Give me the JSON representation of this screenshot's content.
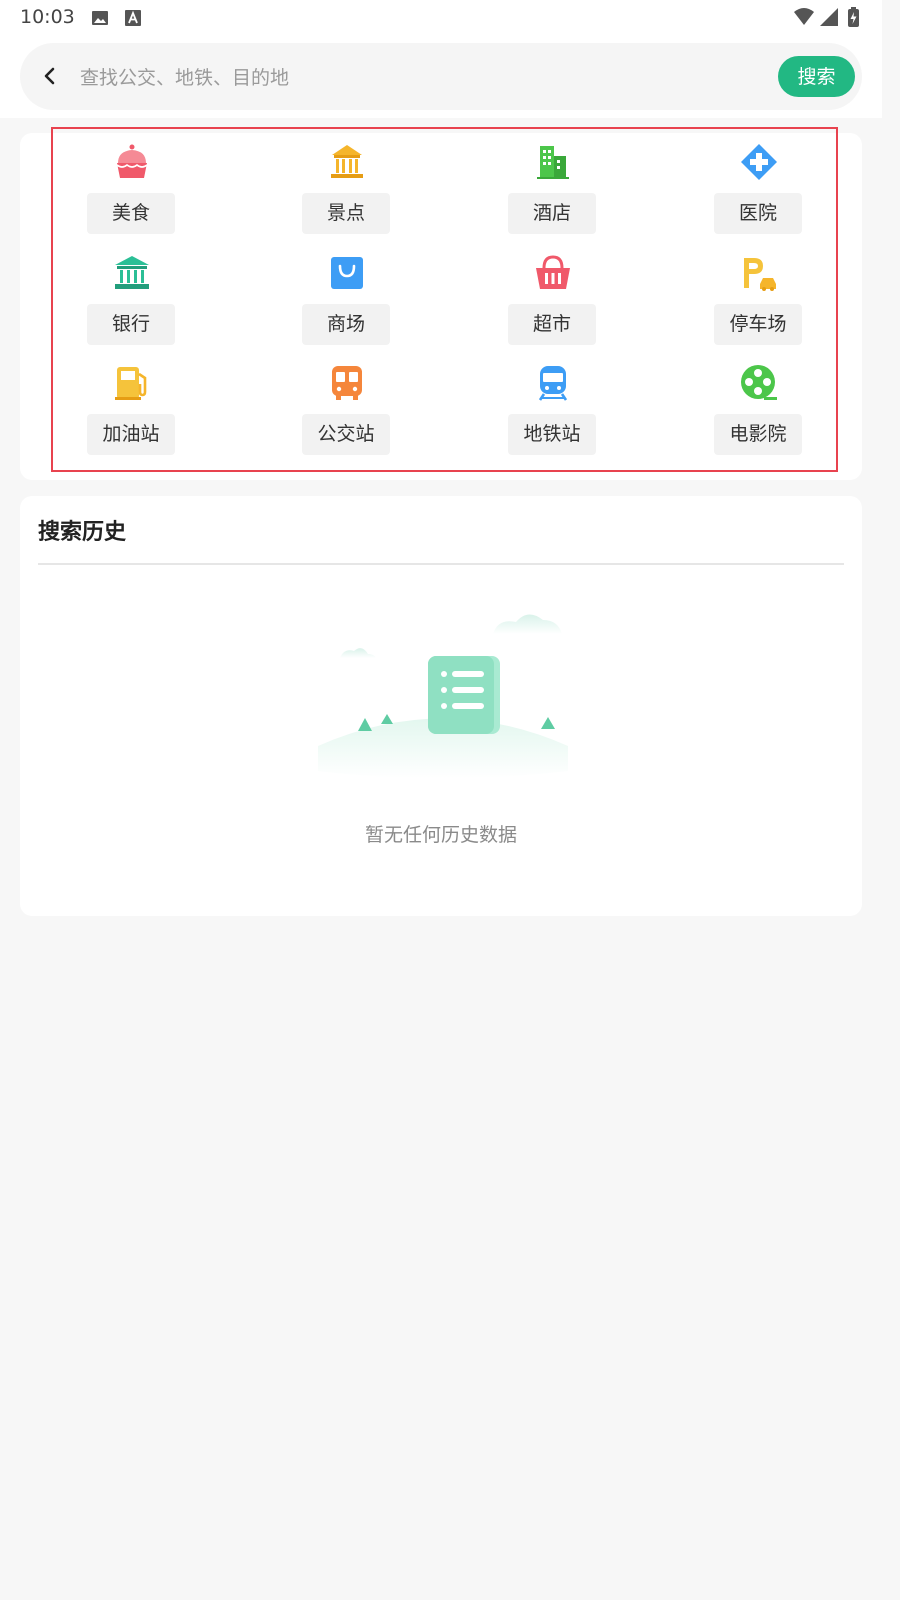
{
  "status_bar": {
    "time": "10:03",
    "left_icons": [
      "image-icon",
      "text-notification-icon"
    ],
    "right_icons": [
      "wifi-icon",
      "signal-icon",
      "battery-charging-icon"
    ]
  },
  "search": {
    "placeholder": "查找公交、地铁、目的地",
    "value": "",
    "button_label": "搜索",
    "accent_color": "#22b883"
  },
  "categories": [
    {
      "label": "美食",
      "icon": "cupcake-icon",
      "color": "#f0596a"
    },
    {
      "label": "景点",
      "icon": "pavilion-icon",
      "color": "#f5b52b"
    },
    {
      "label": "酒店",
      "icon": "building-icon",
      "color": "#4cc64a"
    },
    {
      "label": "医院",
      "icon": "medical-cross-icon",
      "color": "#3d9df5"
    },
    {
      "label": "银行",
      "icon": "bank-icon",
      "color": "#2bbf96"
    },
    {
      "label": "商场",
      "icon": "shopping-bag-icon",
      "color": "#3d9df5"
    },
    {
      "label": "超市",
      "icon": "basket-icon",
      "color": "#f0596a"
    },
    {
      "label": "停车场",
      "icon": "parking-icon",
      "color": "#f5b52b"
    },
    {
      "label": "加油站",
      "icon": "fuel-pump-icon",
      "color": "#f5b52b"
    },
    {
      "label": "公交站",
      "icon": "bus-icon",
      "color": "#f5863b"
    },
    {
      "label": "地铁站",
      "icon": "subway-icon",
      "color": "#3d9df5"
    },
    {
      "label": "电影院",
      "icon": "film-reel-icon",
      "color": "#4cc64a"
    }
  ],
  "history": {
    "title": "搜索历史",
    "empty_text": "暂无任何历史数据",
    "illustration_icon": "empty-list-icon"
  },
  "highlight_color": "#e8434f"
}
